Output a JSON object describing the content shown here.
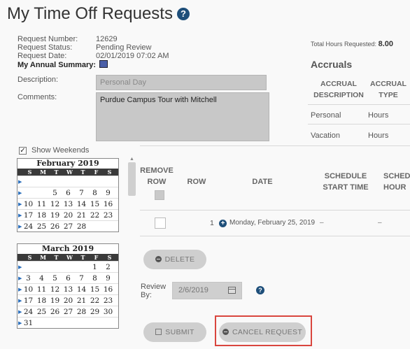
{
  "page": {
    "title": "My Time Off Requests"
  },
  "request": {
    "number_label": "Request Number:",
    "number": "12629",
    "status_label": "Request Status:",
    "status": "Pending Review",
    "date_label": "Request Date:",
    "date": "02/01/2019 07:02 AM",
    "summary_label": "My Annual Summary:",
    "description_label": "Description:",
    "description_placeholder": "Personal Day",
    "comments_label": "Comments:",
    "comments": "Purdue Campus Tour with Mitchell"
  },
  "summary": {
    "total_hours_label": "Total Hours Requested:",
    "total_hours": "8.00"
  },
  "accruals": {
    "title": "Accruals",
    "headers": [
      "ACCRUAL",
      "DESCRIPTION",
      "ACCRUAL",
      "TYPE"
    ],
    "rows": [
      {
        "description": "Personal",
        "type": "Hours"
      },
      {
        "description": "Vacation",
        "type": "Hours"
      }
    ]
  },
  "calendar_options": {
    "show_weekends_label": "Show Weekends",
    "show_weekends_checked": true
  },
  "calendars": [
    {
      "title": "February 2019",
      "dows": [
        "S",
        "M",
        "T",
        "W",
        "T",
        "F",
        "S"
      ],
      "weeks": [
        [
          "",
          "",
          "",
          "",
          "",
          "",
          ""
        ],
        [
          "",
          "",
          "5",
          "6",
          "7",
          "8",
          "9"
        ],
        [
          "10",
          "11",
          "12",
          "13",
          "14",
          "15",
          "16"
        ],
        [
          "17",
          "18",
          "19",
          "20",
          "21",
          "22",
          "23"
        ],
        [
          "24",
          "25",
          "26",
          "27",
          "28",
          "",
          ""
        ]
      ]
    },
    {
      "title": "March 2019",
      "dows": [
        "S",
        "M",
        "T",
        "W",
        "T",
        "F",
        "S"
      ],
      "weeks": [
        [
          "",
          "",
          "",
          "",
          "",
          "1",
          "2"
        ],
        [
          "3",
          "4",
          "5",
          "6",
          "7",
          "8",
          "9"
        ],
        [
          "10",
          "11",
          "12",
          "13",
          "14",
          "15",
          "16"
        ],
        [
          "17",
          "18",
          "19",
          "20",
          "21",
          "22",
          "23"
        ],
        [
          "24",
          "25",
          "26",
          "27",
          "28",
          "29",
          "30"
        ],
        [
          "31",
          "",
          "",
          "",
          "",
          "",
          ""
        ]
      ]
    }
  ],
  "table": {
    "headers": {
      "remove_1": "REMOVE",
      "remove_2": "ROW",
      "row": "ROW",
      "date": "DATE",
      "sched_start_1": "SCHEDULE",
      "sched_start_2": "START TIME",
      "sched_hours_1": "SCHEDU",
      "sched_hours_2": "HOUR"
    },
    "rows": [
      {
        "row": "1",
        "date": "Monday, February 25, 2019",
        "start": "–",
        "hours": "–"
      }
    ]
  },
  "actions": {
    "delete_label": "DELETE",
    "review_by_label_1": "Review",
    "review_by_label_2": "By:",
    "review_by_value": "2/6/2019",
    "submit_label": "SUBMIT",
    "cancel_label": "CANCEL REQUEST"
  },
  "colors": {
    "accent": "#1e4f7a",
    "highlight": "#d9463e"
  },
  "icons": [
    "help-icon",
    "calendar-icon",
    "plus-circle-icon",
    "minus-circle-icon",
    "save-icon",
    "checkmark-icon"
  ]
}
